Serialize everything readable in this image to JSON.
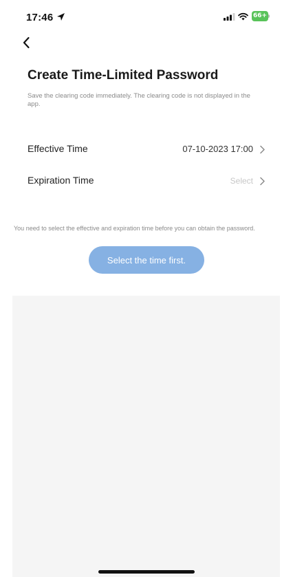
{
  "status_bar": {
    "time": "17:46",
    "battery_level": "66+",
    "icons": [
      "location-arrow-icon",
      "cellular-signal-icon",
      "wifi-icon",
      "battery-icon"
    ]
  },
  "nav": {
    "back_icon": "chevron-left-icon"
  },
  "header": {
    "title": "Create Time-Limited Password",
    "subtitle": "Save the clearing code immediately. The clearing code is not displayed in the app."
  },
  "form": {
    "effective_time": {
      "label": "Effective Time",
      "value": "07-10-2023 17:00"
    },
    "expiration_time": {
      "label": "Expiration Time",
      "placeholder": "Select"
    }
  },
  "hint": "You need to select the effective and expiration time before you can obtain the password.",
  "primary_button": {
    "label": "Select the time first."
  },
  "colors": {
    "button_bg": "#86b1e3",
    "battery": "#59c35a",
    "panel_bg": "#f5f5f5"
  }
}
